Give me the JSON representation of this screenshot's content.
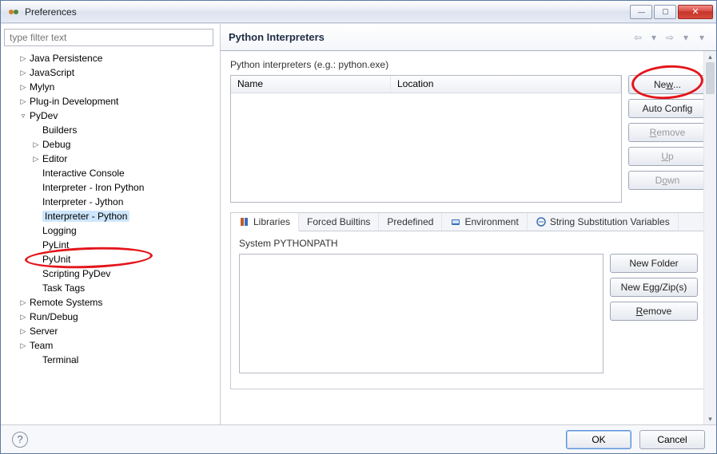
{
  "window": {
    "title": "Preferences"
  },
  "filter_placeholder": "type filter text",
  "tree": [
    {
      "indent": 0,
      "tw": "▷",
      "label": "Java Persistence"
    },
    {
      "indent": 0,
      "tw": "▷",
      "label": "JavaScript"
    },
    {
      "indent": 0,
      "tw": "▷",
      "label": "Mylyn"
    },
    {
      "indent": 0,
      "tw": "▷",
      "label": "Plug-in Development"
    },
    {
      "indent": 0,
      "tw": "▿",
      "label": "PyDev"
    },
    {
      "indent": 1,
      "tw": "",
      "label": "Builders"
    },
    {
      "indent": 1,
      "tw": "▷",
      "label": "Debug"
    },
    {
      "indent": 1,
      "tw": "▷",
      "label": "Editor"
    },
    {
      "indent": 1,
      "tw": "",
      "label": "Interactive Console"
    },
    {
      "indent": 1,
      "tw": "",
      "label": "Interpreter - Iron Python"
    },
    {
      "indent": 1,
      "tw": "",
      "label": "Interpreter - Jython"
    },
    {
      "indent": 1,
      "tw": "",
      "label": "Interpreter - Python",
      "selected": true
    },
    {
      "indent": 1,
      "tw": "",
      "label": "Logging"
    },
    {
      "indent": 1,
      "tw": "",
      "label": "PyLint"
    },
    {
      "indent": 1,
      "tw": "",
      "label": "PyUnit"
    },
    {
      "indent": 1,
      "tw": "",
      "label": "Scripting PyDev"
    },
    {
      "indent": 1,
      "tw": "",
      "label": "Task Tags"
    },
    {
      "indent": 0,
      "tw": "▷",
      "label": "Remote Systems"
    },
    {
      "indent": 0,
      "tw": "▷",
      "label": "Run/Debug"
    },
    {
      "indent": 0,
      "tw": "▷",
      "label": "Server"
    },
    {
      "indent": 0,
      "tw": "▷",
      "label": "Team"
    },
    {
      "indent": 1,
      "tw": "",
      "label": "Terminal"
    }
  ],
  "panel": {
    "title": "Python Interpreters",
    "description": "Python interpreters (e.g.: python.exe)",
    "columns": {
      "name": "Name",
      "location": "Location"
    },
    "buttons": {
      "new": "New...",
      "new_u": "w",
      "auto": "Auto Config",
      "remove": "Remove",
      "remove_u": "R",
      "up": "Up",
      "up_u": "U",
      "down": "Down",
      "down_u": "o"
    },
    "tabs": {
      "libraries": "Libraries",
      "forced": "Forced Builtins",
      "predefined": "Predefined",
      "environment": "Environment",
      "stringsub": "String Substitution Variables"
    },
    "libraries_label": "System PYTHONPATH",
    "libbtns": {
      "newfolder": "New Folder",
      "newegg": "New Egg/Zip(s)",
      "remove": "Remove",
      "remove_u": "R"
    }
  },
  "footer": {
    "ok": "OK",
    "cancel": "Cancel"
  }
}
